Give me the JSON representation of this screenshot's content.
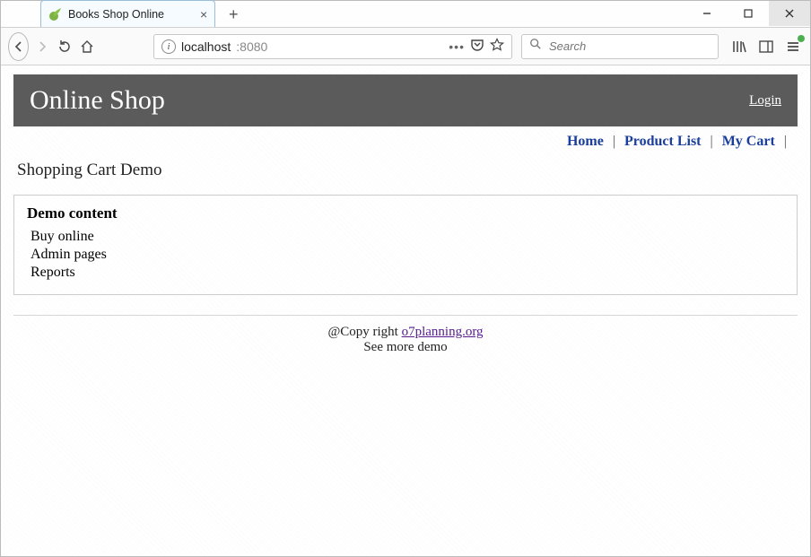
{
  "browser": {
    "tab_title": "Books Shop Online",
    "url_host": "localhost",
    "url_port": ":8080",
    "search_placeholder": "Search"
  },
  "site": {
    "title": "Online Shop",
    "login_label": "Login"
  },
  "menu": {
    "home": "Home",
    "product_list": "Product List",
    "my_cart": "My Cart",
    "sep": "|"
  },
  "page": {
    "title": "Shopping Cart Demo"
  },
  "demo": {
    "heading": "Demo content",
    "items": [
      "Buy online",
      "Admin pages",
      "Reports"
    ]
  },
  "footer": {
    "copy_prefix": "@Copy right ",
    "link_text": "o7planning.org",
    "more": "See more demo"
  }
}
